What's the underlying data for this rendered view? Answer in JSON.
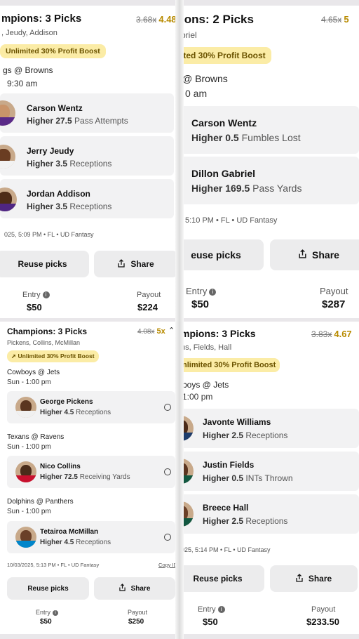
{
  "panels": [
    {
      "title": "mpions: 3 Picks",
      "odds_old": "3.68x",
      "odds_new": "4.48",
      "players": ", Jeudy, Addison",
      "boost": "Unlimited 30% Profit Boost",
      "game": "gs @ Browns",
      "time": "9:30 am",
      "picks": [
        {
          "name": "Carson Wentz",
          "value": "Higher 27.5",
          "stat": "Pass Attempts"
        },
        {
          "name": "Jerry Jeudy",
          "value": "Higher 3.5",
          "stat": "Receptions"
        },
        {
          "name": "Jordan Addison",
          "value": "Higher 3.5",
          "stat": "Receptions"
        }
      ],
      "meta": "025, 5:09 PM • FL • UD Fantasy",
      "reuse": "Reuse picks",
      "share": "Share",
      "entry_label": "Entry",
      "entry": "$50",
      "payout_label": "Payout",
      "payout": "$224"
    },
    {
      "title": "ions: 2 Picks",
      "odds_old": "4.65x",
      "odds_new": "5",
      "players": "briel",
      "boost": "ited 30% Profit Boost",
      "game": "@ Browns",
      "time": "0 am",
      "picks": [
        {
          "name": "Carson Wentz",
          "value": "Higher 0.5",
          "stat": "Fumbles Lost"
        },
        {
          "name": "Dillon Gabriel",
          "value": "Higher 169.5",
          "stat": "Pass Yards"
        }
      ],
      "meta": "5:10 PM • FL • UD Fantasy",
      "reuse": "euse picks",
      "share": "Share",
      "entry_label": "Entry",
      "entry": "$50",
      "payout_label": "Payout",
      "payout": "$287"
    },
    {
      "title": "Champions: 3 Picks",
      "odds_old": "4.08x",
      "odds_new": "5x",
      "players": "Pickens, Collins, McMillan",
      "boost": "Unlimited 30% Profit Boost",
      "games": [
        {
          "game": "Cowboys @ Jets",
          "time": "Sun - 1:00 pm"
        },
        {
          "game": "Texans @ Ravens",
          "time": "Sun - 1:00 pm"
        },
        {
          "game": "Dolphins @ Panthers",
          "time": "Sun - 1:00 pm"
        }
      ],
      "picks": [
        {
          "name": "George Pickens",
          "value": "Higher 4.5",
          "stat": "Receptions"
        },
        {
          "name": "Nico Collins",
          "value": "Higher 72.5",
          "stat": "Receiving Yards"
        },
        {
          "name": "Tetairoa McMillan",
          "value": "Higher 4.5",
          "stat": "Receptions"
        }
      ],
      "meta": "10/03/2025, 5:13 PM • FL • UD Fantasy",
      "copy_id": "Copy ID",
      "reuse": "Reuse picks",
      "share": "Share",
      "entry_label": "Entry",
      "entry": "$50",
      "payout_label": "Payout",
      "payout": "$250"
    },
    {
      "title": "mpions: 3 Picks",
      "odds_old": "3.83x",
      "odds_new": "4.67",
      "players": "ns, Fields, Hall",
      "boost": "nlimited 30% Profit Boost",
      "game": "boys @ Jets",
      "time": "1:00 pm",
      "picks": [
        {
          "name": "Javonte Williams",
          "value": "Higher 2.5",
          "stat": "Receptions"
        },
        {
          "name": "Justin Fields",
          "value": "Higher 0.5",
          "stat": "INTs Thrown"
        },
        {
          "name": "Breece Hall",
          "value": "Higher 2.5",
          "stat": "Receptions"
        }
      ],
      "meta": "025, 5:14 PM • FL • UD Fantasy",
      "reuse": "Reuse picks",
      "share": "Share",
      "entry_label": "Entry",
      "entry": "$50",
      "payout_label": "Payout",
      "payout": "$233.50"
    }
  ]
}
